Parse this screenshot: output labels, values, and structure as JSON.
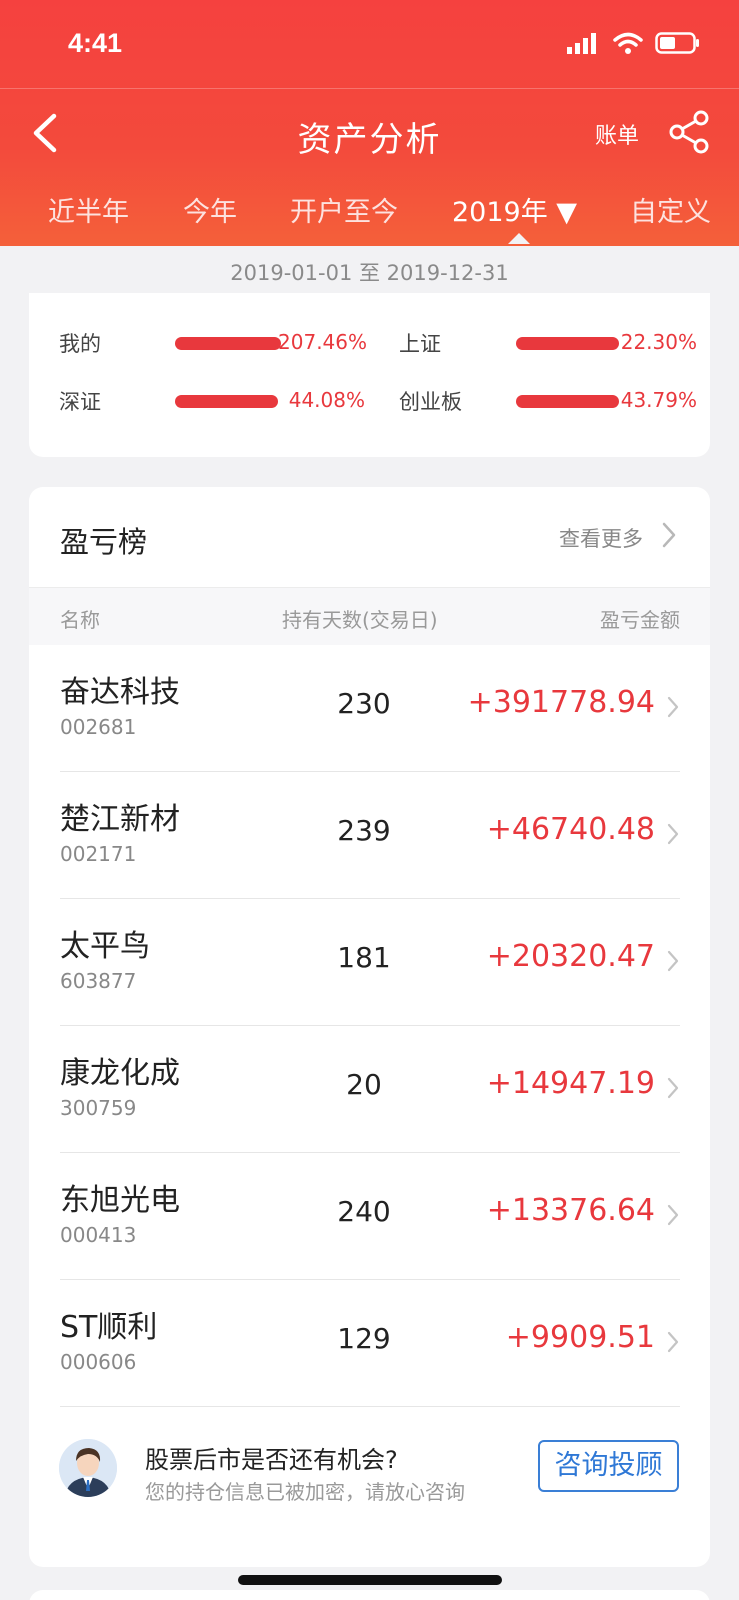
{
  "status_bar": {
    "time": "4:41"
  },
  "navbar": {
    "title": "资产分析",
    "bill_label": "账单"
  },
  "tabs": [
    {
      "label": "近半年",
      "active": false
    },
    {
      "label": "今年",
      "active": false
    },
    {
      "label": "开户至今",
      "active": false
    },
    {
      "label": "2019年 ▼",
      "active": true
    },
    {
      "label": "自定义",
      "active": false
    }
  ],
  "date_range": "2019-01-01 至 2019-12-31",
  "comparison": {
    "accent_color": "#e8383d",
    "items": [
      {
        "label": "我的",
        "value": "207.46%",
        "bar_fill": 1.0
      },
      {
        "label": "上证",
        "value": "22.30%",
        "bar_fill": 0.97
      },
      {
        "label": "深证",
        "value": "44.08%",
        "bar_fill": 0.97
      },
      {
        "label": "创业板",
        "value": "43.79%",
        "bar_fill": 0.97
      }
    ]
  },
  "ranking": {
    "title": "盈亏榜",
    "more_label": "查看更多",
    "columns": {
      "name": "名称",
      "days": "持有天数(交易日)",
      "pnl": "盈亏金额"
    },
    "rows": [
      {
        "name": "奋达科技",
        "code": "002681",
        "days": "230",
        "pnl": "+391778.94"
      },
      {
        "name": "楚江新材",
        "code": "002171",
        "days": "239",
        "pnl": "+46740.48"
      },
      {
        "name": "太平鸟",
        "code": "603877",
        "days": "181",
        "pnl": "+20320.47"
      },
      {
        "name": "康龙化成",
        "code": "300759",
        "days": "20",
        "pnl": "+14947.19"
      },
      {
        "name": "东旭光电",
        "code": "000413",
        "days": "240",
        "pnl": "+13376.64"
      },
      {
        "name": "ST顺利",
        "code": "000606",
        "days": "129",
        "pnl": "+9909.51"
      }
    ]
  },
  "consult": {
    "title": "股票后市是否还有机会?",
    "subtitle": "您的持仓信息已被加密，请放心咨询",
    "button_label": "咨询投顾",
    "button_color": "#2f78d6"
  }
}
